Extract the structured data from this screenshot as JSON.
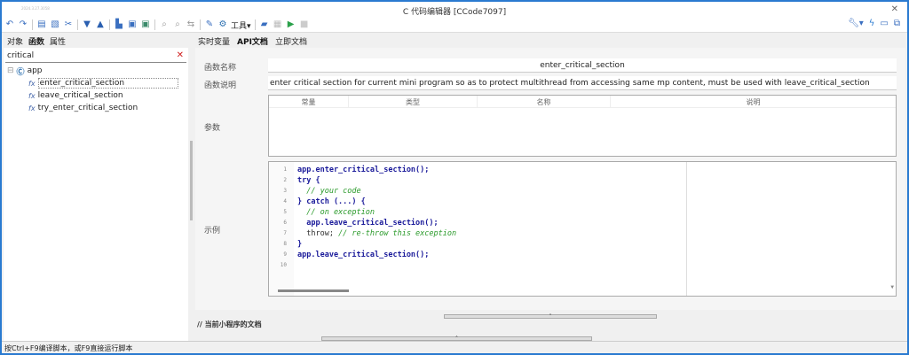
{
  "window": {
    "title": "C 代码编辑器 [CCode7097]",
    "date": "2024.3.27.3058"
  },
  "toolbar": {
    "tools_label": "工具"
  },
  "left": {
    "tabs": [
      "对象",
      "函数",
      "属性"
    ],
    "search_value": "critical",
    "tree": {
      "root": "app",
      "items": [
        "enter_critical_section",
        "leave_critical_section",
        "try_enter_critical_section"
      ]
    }
  },
  "right": {
    "tabs": [
      "实时变量",
      "API文档",
      "立即文档"
    ],
    "name_label": "函数名称",
    "name_value": "enter_critical_section",
    "desc_label": "函数说明",
    "desc_value": "enter critical section for current mini program so as to protect multithread from accessing same mp content, must be used with leave_critical_section",
    "params_label": "参数",
    "params_headers": [
      "常量",
      "类型",
      "名称",
      "说明"
    ],
    "example_label": "示例",
    "code": [
      [
        {
          "t": "kw",
          "s": "app.enter_critical_section();"
        }
      ],
      [
        {
          "t": "kw",
          "s": "try {"
        }
      ],
      [
        {
          "t": "cm",
          "s": "  // your code"
        }
      ],
      [
        {
          "t": "kw",
          "s": "} catch (...) {"
        }
      ],
      [
        {
          "t": "cm",
          "s": "  // on exception"
        }
      ],
      [
        {
          "t": "kw",
          "s": "  app.leave_critical_section();"
        }
      ],
      [
        {
          "t": "tx",
          "s": "  throw; "
        },
        {
          "t": "cm",
          "s": "// re-throw this exception"
        }
      ],
      [
        {
          "t": "kw",
          "s": "}"
        }
      ],
      [
        {
          "t": "kw",
          "s": "app.leave_critical_section();"
        }
      ],
      []
    ],
    "doc_heading": "// 当前小程序的文档"
  },
  "status": "按Ctrl+F9编译脚本，或F9直接运行脚本"
}
